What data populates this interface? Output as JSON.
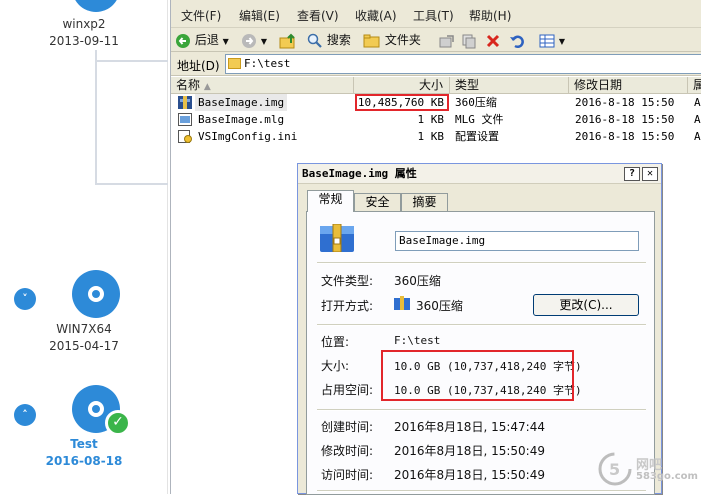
{
  "timeline": {
    "items": [
      {
        "name": "winxp2",
        "date": "2013-09-11"
      },
      {
        "name": "WIN7X64",
        "date": "2015-04-17"
      },
      {
        "name": "Test",
        "date": "2016-08-18"
      }
    ],
    "toggle_collapse": "˅",
    "toggle_expand": "˄",
    "check_mark": "✓",
    "accent": "#2d8ad8"
  },
  "explorer": {
    "menu": [
      "文件(F)",
      "编辑(E)",
      "查看(V)",
      "收藏(A)",
      "工具(T)",
      "帮助(H)"
    ],
    "toolbar": {
      "back": "后退",
      "search": "搜索",
      "folders": "文件夹"
    },
    "address_label": "地址(D)",
    "address_value": "F:\\test",
    "columns": [
      "名称",
      "大小",
      "类型",
      "修改日期",
      "属"
    ],
    "files": [
      {
        "name": "BaseImage.img",
        "size": "10,485,760 KB",
        "type": "360压缩",
        "date": "2016-8-18 15:50",
        "attr": "A"
      },
      {
        "name": "BaseImage.mlg",
        "size": "1 KB",
        "type": "MLG 文件",
        "date": "2016-8-18 15:50",
        "attr": "A"
      },
      {
        "name": "VSImgConfig.ini",
        "size": "1 KB",
        "type": "配置设置",
        "date": "2016-8-18 15:50",
        "attr": "A"
      }
    ]
  },
  "dialog": {
    "title": "BaseImage.img 属性",
    "help_btn": "?",
    "close_btn": "✕",
    "tabs": [
      "常规",
      "安全",
      "摘要"
    ],
    "filename": "BaseImage.img",
    "file_type_label": "文件类型:",
    "file_type": "360压缩",
    "open_with_label": "打开方式:",
    "open_with": "360压缩",
    "change_button": "更改(C)...",
    "location_label": "位置:",
    "location": "F:\\test",
    "size_label": "大小:",
    "size": "10.0 GB (10,737,418,240 字节)",
    "disk_size_label": "占用空间:",
    "disk_size": "10.0 GB (10,737,418,240 字节)",
    "created_label": "创建时间:",
    "created": "2016年8月18日, 15:47:44",
    "modified_label": "修改时间:",
    "modified": "2016年8月18日, 15:50:49",
    "accessed_label": "访问时间:",
    "accessed": "2016年8月18日, 15:50:49"
  },
  "watermark": {
    "brand": "网吧",
    "site": "583go.com"
  }
}
